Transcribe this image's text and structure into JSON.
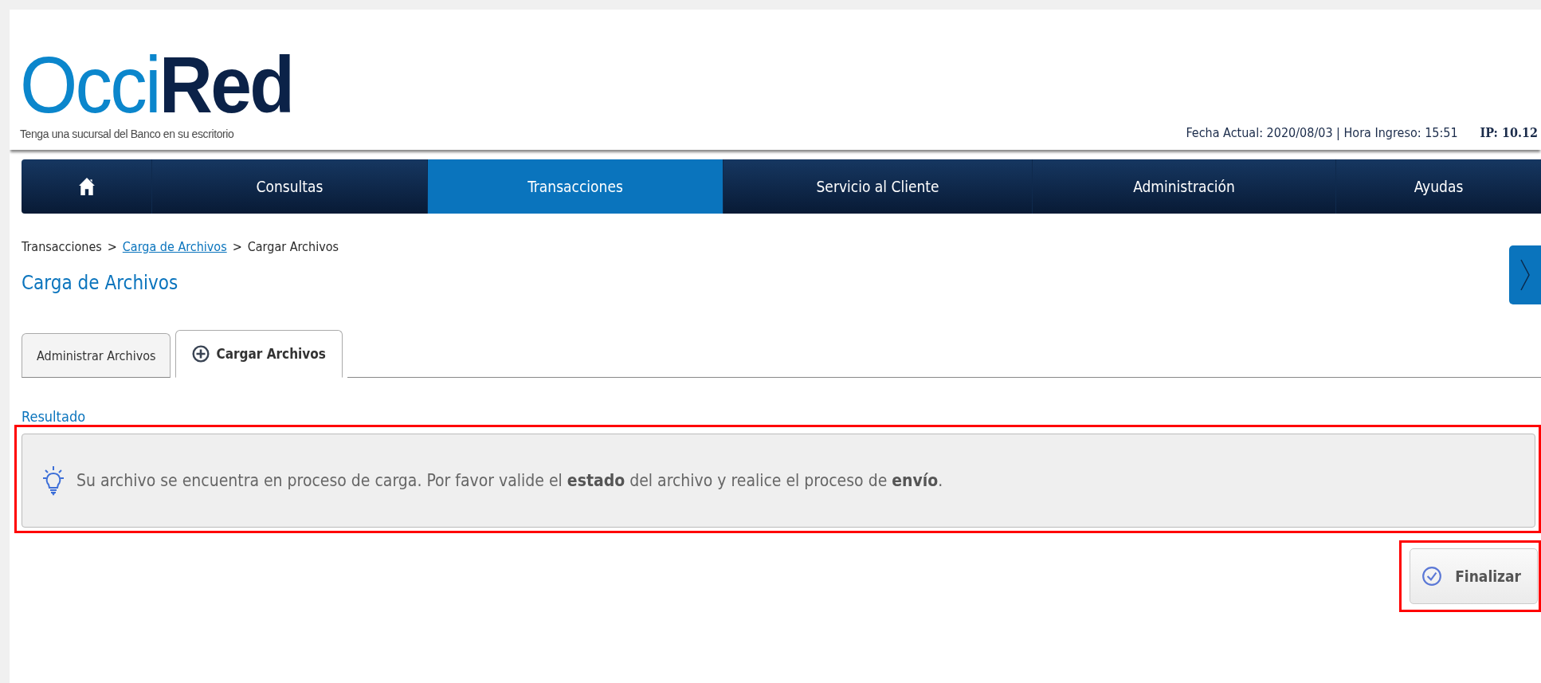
{
  "header": {
    "logo": {
      "part_1": "Occi",
      "part_2": "Red"
    },
    "tagline": "Tenga una sucursal del Banco en su escritorio",
    "session_info": "Fecha Actual: 2020/08/03 | Hora Ingreso: 15:51",
    "ip": "IP: 10.12"
  },
  "nav": [
    {
      "kind": "home",
      "selected": false
    },
    {
      "kind": "text",
      "label": "Consultas",
      "selected": false
    },
    {
      "kind": "text",
      "label": "Transacciones",
      "selected": true
    },
    {
      "kind": "text",
      "label": "Servicio al Cliente",
      "selected": false
    },
    {
      "kind": "text",
      "label": "Administración",
      "selected": false
    },
    {
      "kind": "text",
      "label": "Ayudas",
      "selected": false
    }
  ],
  "breadcrumb": [
    {
      "label": "Transacciones",
      "kind": "text"
    },
    {
      "label": ">",
      "kind": "separator"
    },
    {
      "label": "Carga de Archivos",
      "kind": "link"
    },
    {
      "label": ">",
      "kind": "separator"
    },
    {
      "label": "Cargar Archivos",
      "kind": "text"
    }
  ],
  "page_title": "Carga de Archivos",
  "tabs": [
    {
      "label": "Administrar Archivos",
      "kind": "plain",
      "selected": false
    },
    {
      "label": "Cargar Archivos",
      "kind": "add",
      "selected": true
    }
  ],
  "section_title": "Resultado",
  "message": {
    "text": "Su archivo se encuentra en proceso de carga. Por favor valide el **estado** del archivo y realice el proceso de **envío**.",
    "highlighted": true
  },
  "finish_button": {
    "label": "Finalizar",
    "highlighted": true
  }
}
